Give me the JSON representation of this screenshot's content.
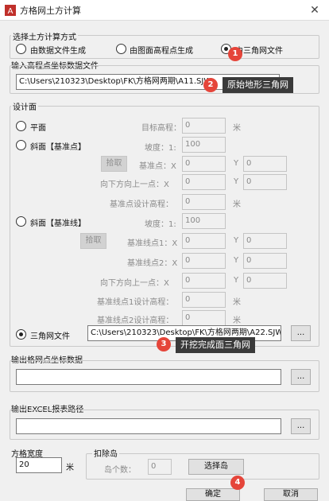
{
  "window": {
    "title": "方格网土方计算",
    "close_label": "✕"
  },
  "method_group": {
    "title": "选择土方计算方式",
    "options": [
      "由数据文件生成",
      "由图面高程点生成",
      "由三角网文件"
    ],
    "selected": 2
  },
  "source_file": {
    "title": "输入高程点坐标数据文件",
    "value": "C:\\Users\\210323\\Desktop\\FK\\方格网两期\\A11.SJW"
  },
  "design": {
    "title": "设计面",
    "plane": {
      "label": "平面",
      "target_elev_label": "目标高程：",
      "target_elev": "0",
      "unit": "米"
    },
    "slope_point": {
      "label": "斜面【基准点】",
      "slope_label": "坡度：1:",
      "slope": "100",
      "pick_label": "拾取",
      "base_x_label": "基准点：X",
      "base_x": "0",
      "base_y_label": "Y",
      "base_y": "0",
      "down_x_label": "向下方向上一点：X",
      "down_x": "0",
      "down_y_label": "Y",
      "down_y": "0",
      "base_elev_label": "基准点设计高程：",
      "base_elev": "0",
      "unit": "米"
    },
    "slope_line": {
      "label": "斜面【基准线】",
      "slope_label": "坡度：1:",
      "slope": "100",
      "pick_label": "拾取",
      "p1_x_label": "基准线点1：X",
      "p1_x": "0",
      "p1_y_label": "Y",
      "p1_y": "0",
      "p2_x_label": "基准线点2：X",
      "p2_x": "0",
      "p2_y_label": "Y",
      "p2_y": "0",
      "down_x_label": "向下方向上一点：X",
      "down_x": "0",
      "down_y_label": "Y",
      "down_y": "0",
      "p1_elev_label": "基准线点1设计高程：",
      "p1_elev": "0",
      "p2_elev_label": "基准线点2设计高程：",
      "p2_elev": "0",
      "unit": "米"
    },
    "tin": {
      "label": "三角网文件",
      "value": "C:\\Users\\210323\\Desktop\\FK\\方格网两期\\A22.SJW",
      "browse_label": "..."
    }
  },
  "grid_output": {
    "title": "输出格网点坐标数据",
    "value": "",
    "browse_label": "..."
  },
  "excel_output": {
    "title": "输出EXCEL报表路径",
    "value": "",
    "browse_label": "..."
  },
  "grid_size": {
    "title": "方格宽度",
    "value": "20",
    "unit": "米"
  },
  "islands": {
    "title": "扣除岛",
    "count_label": "岛个数：",
    "count": "0",
    "select_label": "选择岛"
  },
  "footer": {
    "ok_label": "确定",
    "cancel_label": "取消"
  },
  "annotations": [
    {
      "num": "1"
    },
    {
      "num": "2",
      "text": "原始地形三角网"
    },
    {
      "num": "3",
      "text": "开挖完成面三角网"
    },
    {
      "num": "4"
    }
  ],
  "colors": {
    "badge": "#e5453a",
    "callout_bg": "#3a3a3a"
  }
}
